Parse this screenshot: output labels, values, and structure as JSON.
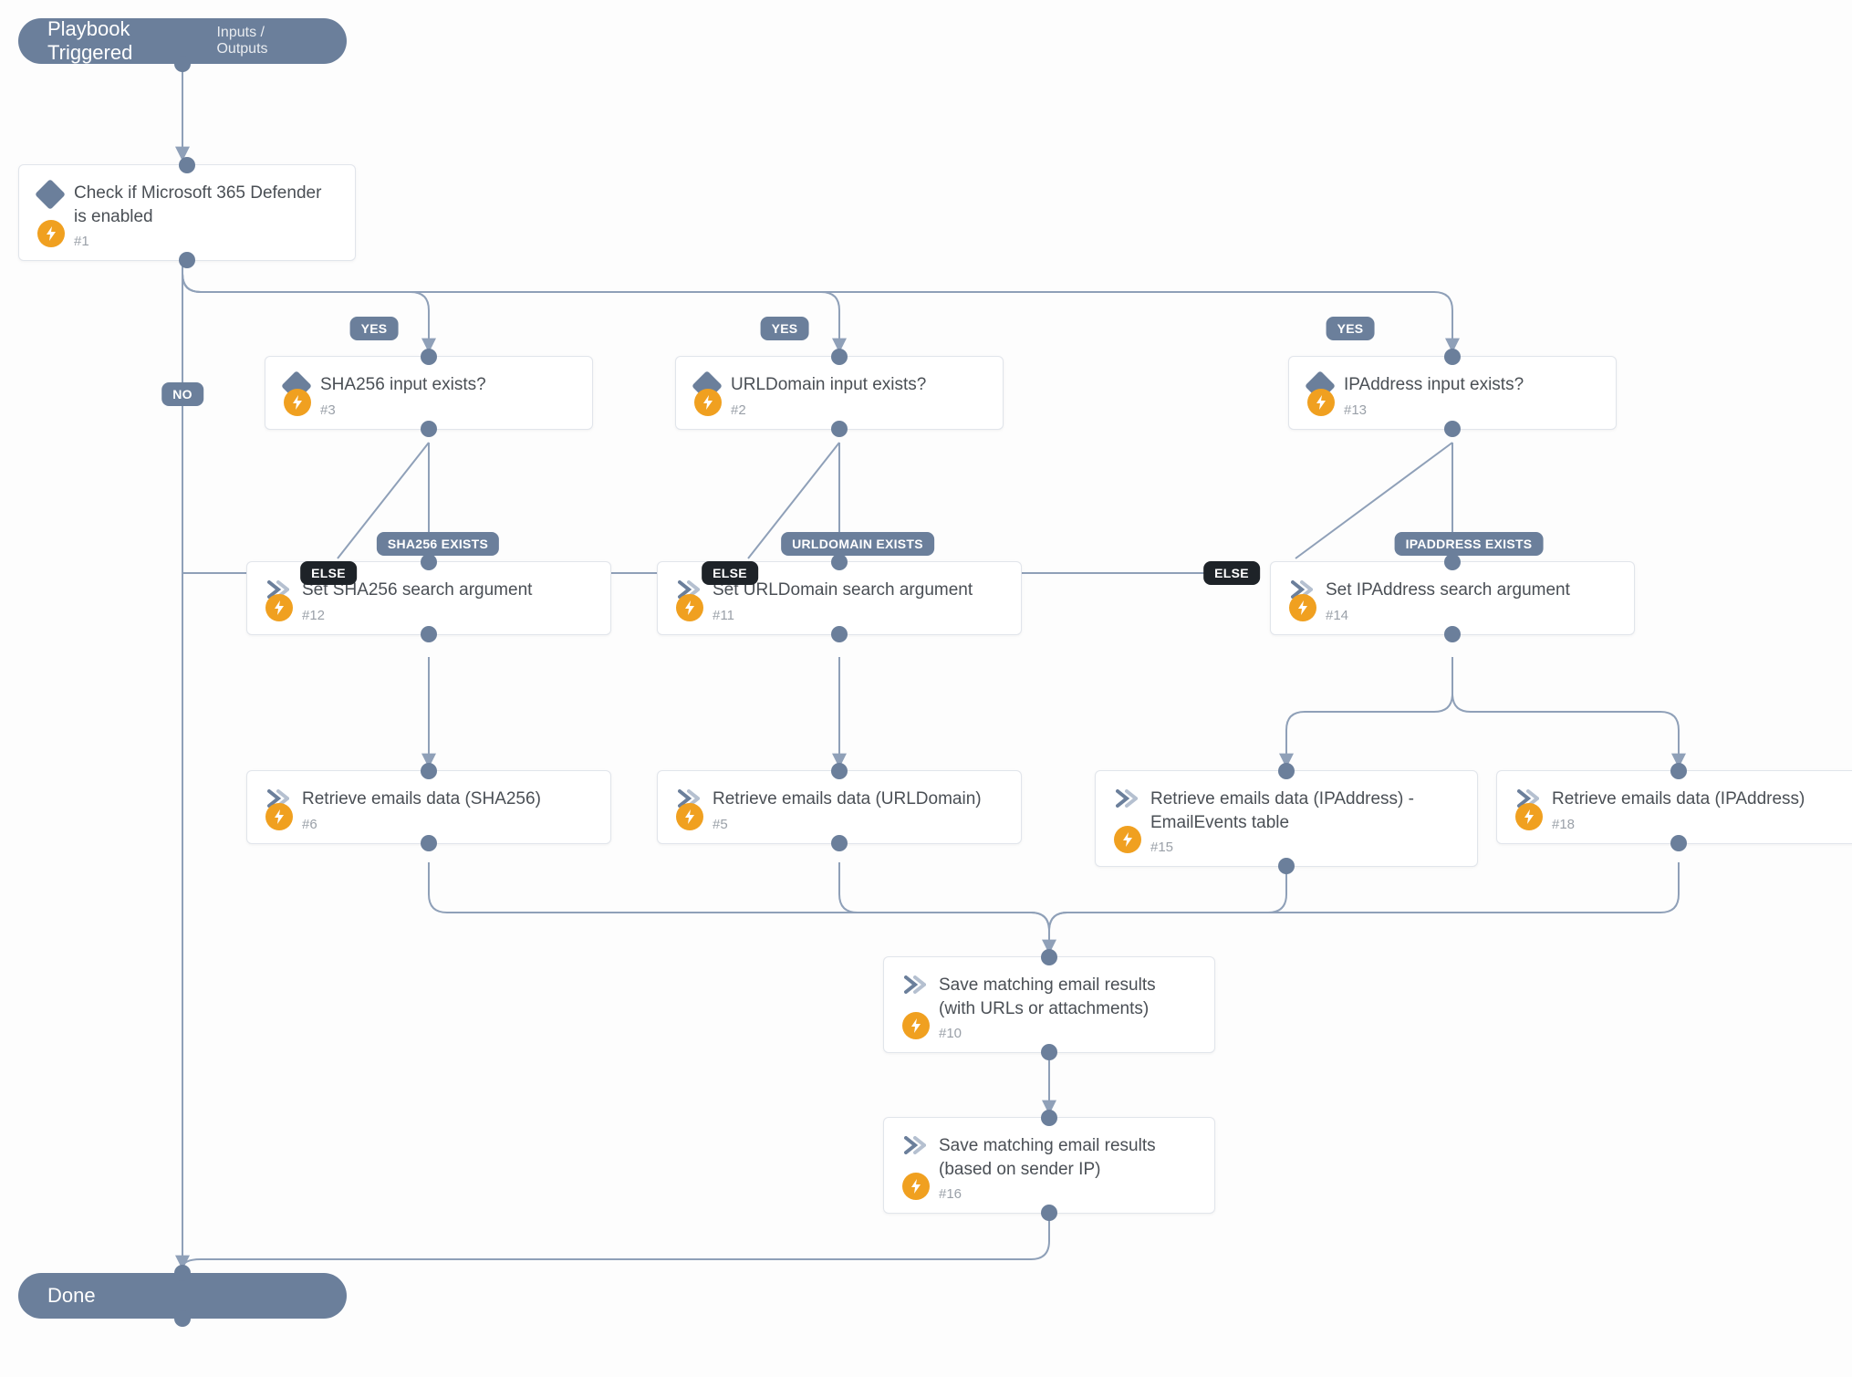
{
  "colors": {
    "slate": "#6b7f9b",
    "amber": "#f0a020",
    "dark": "#1e2328",
    "line": "#8fa0b8"
  },
  "start": {
    "title": "Playbook Triggered",
    "sub": "Inputs / Outputs"
  },
  "end": {
    "title": "Done"
  },
  "nodes": {
    "n1": {
      "title": "Check if Microsoft 365 Defender is enabled",
      "num": "#1",
      "type": "condition"
    },
    "n3": {
      "title": "SHA256 input exists?",
      "num": "#3",
      "type": "condition"
    },
    "n2": {
      "title": "URLDomain input exists?",
      "num": "#2",
      "type": "condition"
    },
    "n13": {
      "title": "IPAddress input exists?",
      "num": "#13",
      "type": "condition"
    },
    "n12": {
      "title": "Set SHA256 search argument",
      "num": "#12",
      "type": "action"
    },
    "n11": {
      "title": "Set URLDomain search argument",
      "num": "#11",
      "type": "action"
    },
    "n14": {
      "title": "Set IPAddress search argument",
      "num": "#14",
      "type": "action"
    },
    "n6": {
      "title": "Retrieve emails data (SHA256)",
      "num": "#6",
      "type": "action"
    },
    "n5": {
      "title": "Retrieve emails data (URLDomain)",
      "num": "#5",
      "type": "action"
    },
    "n15": {
      "title": "Retrieve emails data (IPAddress) - EmailEvents table",
      "num": "#15",
      "type": "action"
    },
    "n18": {
      "title": "Retrieve emails data (IPAddress)",
      "num": "#18",
      "type": "action"
    },
    "n10": {
      "title": "Save matching email results (with URLs or attachments)",
      "num": "#10",
      "type": "action"
    },
    "n16": {
      "title": "Save matching email results (based on sender IP)",
      "num": "#16",
      "type": "action"
    }
  },
  "edge_labels": {
    "no": "NO",
    "yes": "YES",
    "sha": "SHA256 EXISTS",
    "url": "URLDOMAIN EXISTS",
    "ip": "IPADDRESS EXISTS",
    "else": "ELSE"
  }
}
